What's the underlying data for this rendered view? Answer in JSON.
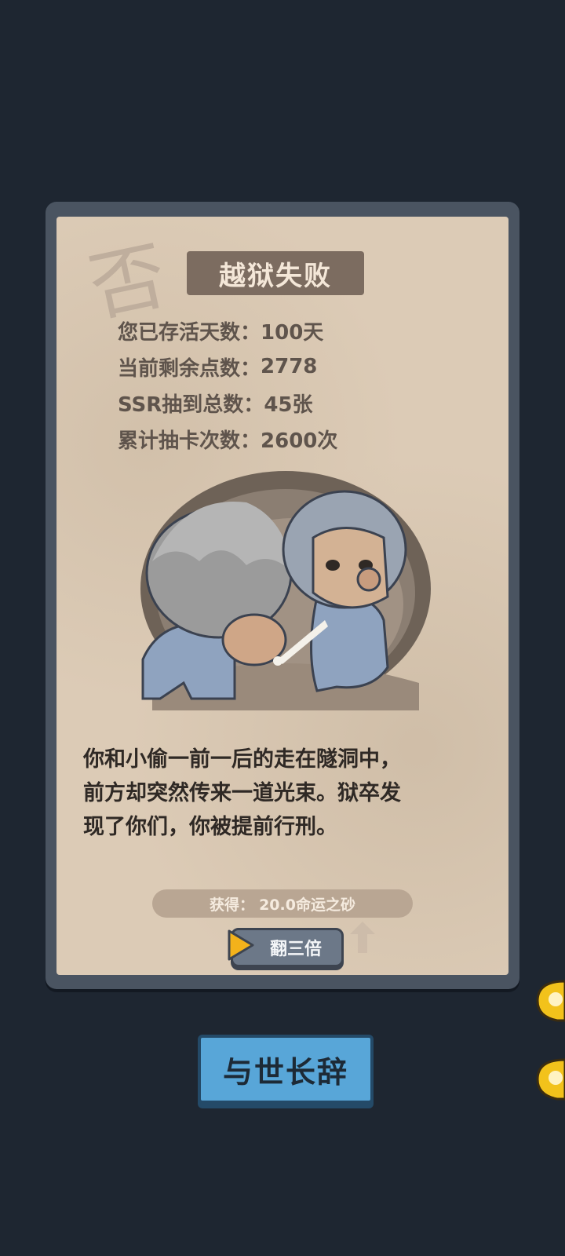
{
  "dialog": {
    "title": "越狱失败",
    "stamp_char": "否",
    "stats": [
      {
        "label": "您已存活天数：",
        "value": "100天"
      },
      {
        "label": "当前剩余点数：",
        "value": "2778"
      },
      {
        "label": "SSR抽到总数：",
        "value": "45张"
      },
      {
        "label": "累计抽卡次数：",
        "value": "2600次"
      }
    ],
    "story_lines": [
      "你和小偷一前一后的走在隧洞中，",
      "前方却突然传来一道光束。狱卒发",
      "现了你们，你被提前行刑。"
    ],
    "reward": {
      "label": "获得：",
      "value": "20.0命运之砂"
    },
    "triple_button": "翻三倍"
  },
  "farewell_button": "与世长辞",
  "colors": {
    "background": "#1e2631",
    "paper": "#dccbb6",
    "accent_button": "#58a6d8",
    "trophy": "#f2c21b"
  },
  "icons": [
    "stamp-icon",
    "play-icon",
    "up-arrow-icon",
    "trophy-icon"
  ]
}
